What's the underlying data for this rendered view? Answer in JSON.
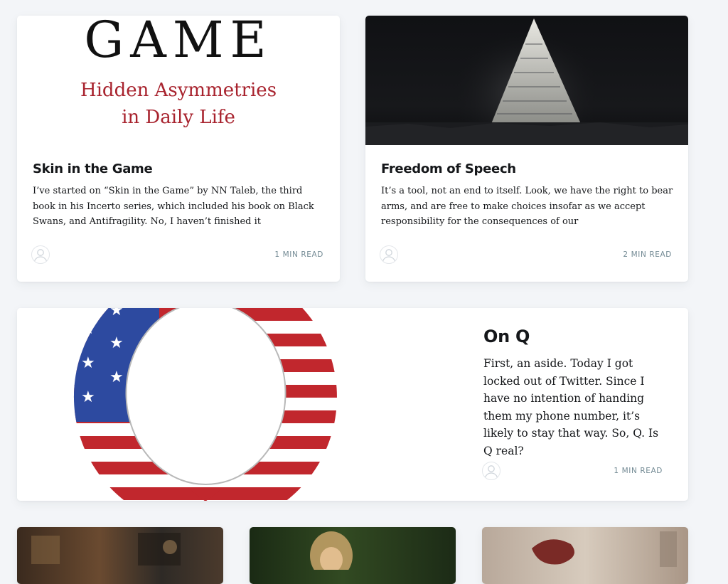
{
  "posts": [
    {
      "title": "Skin in the Game",
      "excerpt": "I’ve started on “Skin in the Game” by NN Taleb, the third book in his Incerto series, which included his book on Black Swans, and Antifragility. No, I haven’t finished it",
      "reading_time": "1 MIN READ",
      "image": {
        "line1": "GAME",
        "line2": "Hidden Asymmetries",
        "line3": "in Daily Life"
      }
    },
    {
      "title": "Freedom of Speech",
      "excerpt": "It’s a tool, not an end to itself. Look, we have the right to bear arms, and are free to make choices insofar as we accept responsibility for the consequences of our",
      "reading_time": "2 MIN READ"
    },
    {
      "title": "On Q",
      "excerpt": "First, an aside. Today I got locked out of Twitter. Since I have no intention of handing them my phone number, it’s likely to stay that way. So, Q. Is Q real?",
      "reading_time": "1 MIN READ"
    }
  ],
  "colors": {
    "page_bg": "#f3f5f8",
    "title": "#15171a",
    "meta": "#738a94",
    "flag_red": "#c1272d",
    "flag_blue": "#2d4aa0"
  }
}
